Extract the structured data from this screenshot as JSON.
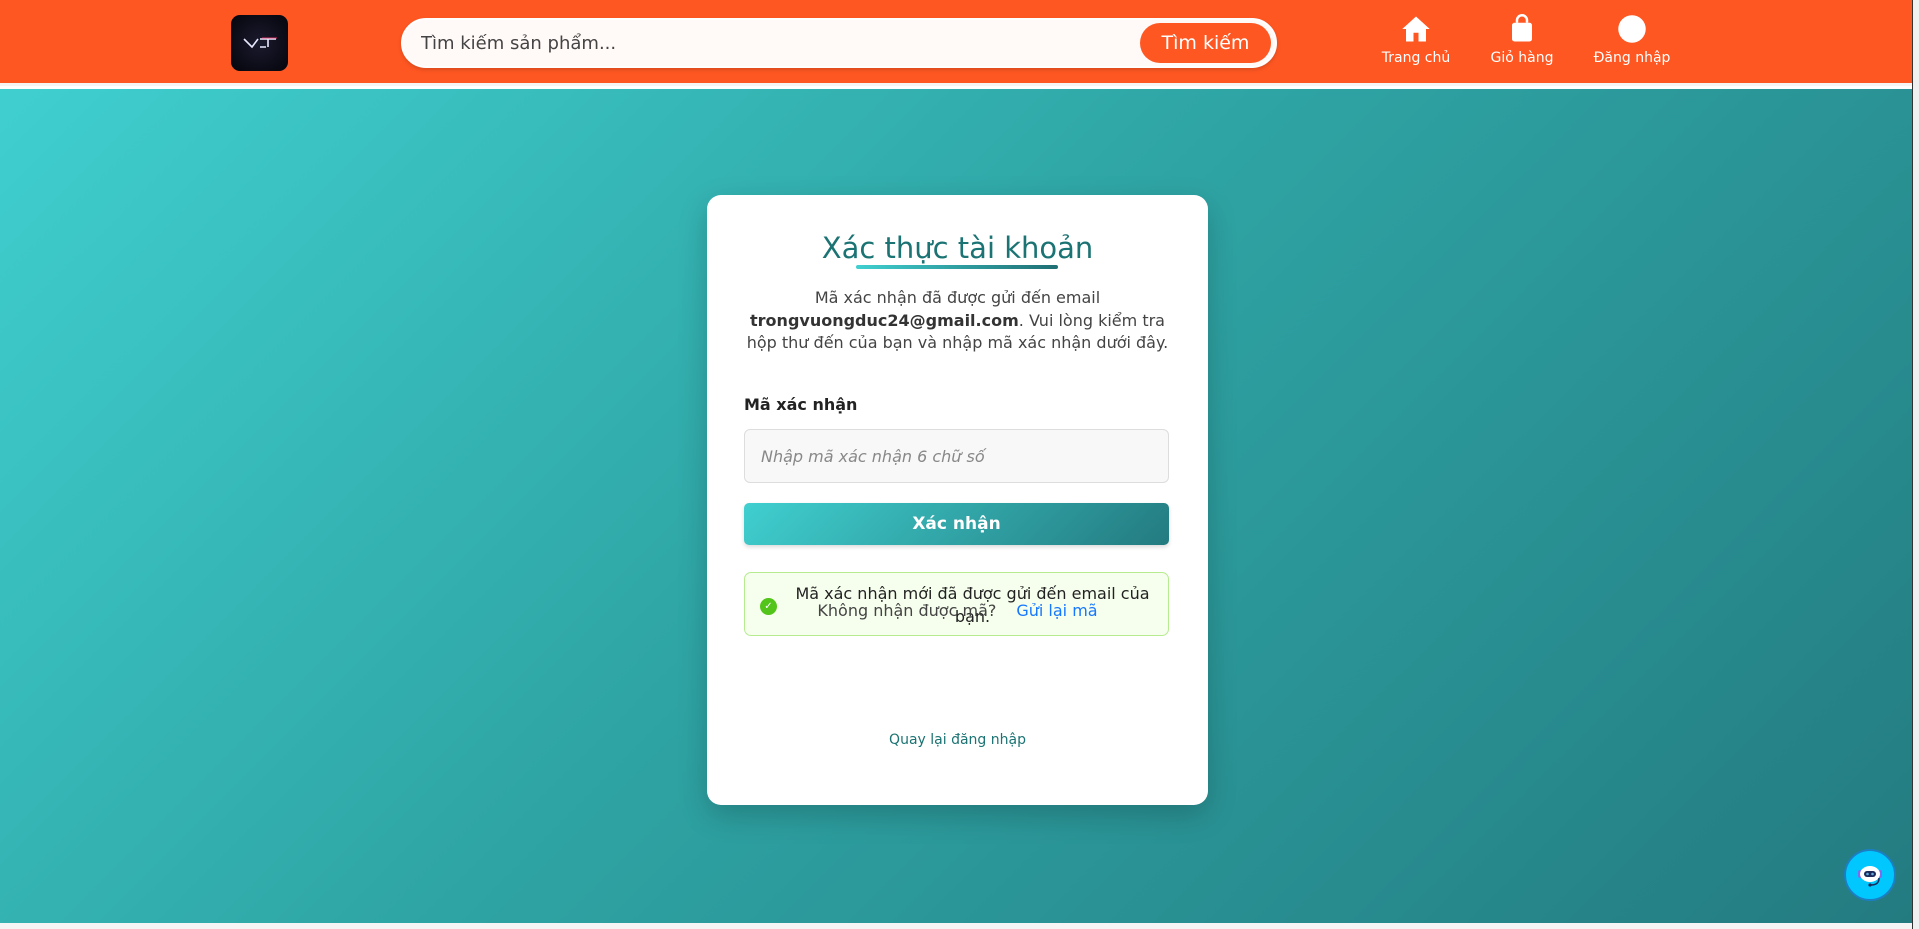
{
  "header": {
    "logo_text": "VCT",
    "search_placeholder": "Tìm kiếm sản phẩm...",
    "search_button": "Tìm kiếm",
    "nav": [
      {
        "label": "Trang chủ",
        "icon": "home-icon"
      },
      {
        "label": "Giỏ hàng",
        "icon": "shopping-bag-icon"
      },
      {
        "label": "Đăng nhập",
        "icon": "user-icon"
      }
    ]
  },
  "card": {
    "title": "Xác thực tài khoản",
    "desc_before": "Mã xác nhận đã được gửi đến email ",
    "email": "trongvuongduc24@gmail.com",
    "desc_after": ". Vui lòng kiểm tra hộp thư đến của bạn và nhập mã xác nhận dưới đây.",
    "code_label": "Mã xác nhận",
    "code_placeholder": "Nhập mã xác nhận 6 chữ số",
    "submit": "Xác nhận",
    "alert": "Mã xác nhận mới đã được gửi đến email của bạn.",
    "resend_prompt": "Không nhận được mã?",
    "resend_link": "Gửi lại mã",
    "back_link": "Quay lại đăng nhập"
  },
  "colors": {
    "header": "#ff5722",
    "accent": "#1b7373",
    "link": "#1677ff",
    "success": "#52c41a"
  }
}
